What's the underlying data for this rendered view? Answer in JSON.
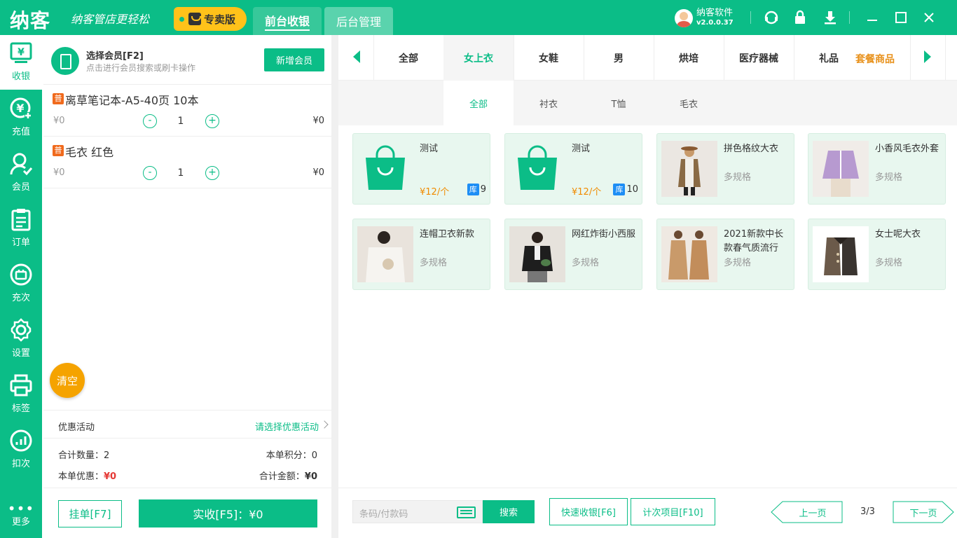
{
  "header": {
    "logo": "纳客",
    "slogan": "纳客管店更轻松",
    "edition": "专卖版",
    "tabs": [
      {
        "label": "前台收银",
        "active": true
      },
      {
        "label": "后台管理",
        "active": false
      }
    ],
    "user_name": "纳客软件",
    "version": "v2.0.0.37",
    "icons": [
      "headset-icon",
      "lock-icon",
      "download-icon"
    ],
    "window_controls": [
      "minimize",
      "maximize",
      "close"
    ]
  },
  "sidebar": {
    "items": [
      {
        "label": "收银",
        "icon": "cashier-icon",
        "active": true
      },
      {
        "label": "充值",
        "icon": "recharge-icon",
        "active": false
      },
      {
        "label": "会员",
        "icon": "member-icon",
        "active": false
      },
      {
        "label": "订单",
        "icon": "order-icon",
        "active": false
      },
      {
        "label": "充次",
        "icon": "count-recharge-icon",
        "active": false
      },
      {
        "label": "设置",
        "icon": "gear-icon",
        "active": false
      },
      {
        "label": "标签",
        "icon": "printer-icon",
        "active": false
      },
      {
        "label": "扣次",
        "icon": "deduct-icon",
        "active": false
      }
    ],
    "more_label": "更多"
  },
  "cart": {
    "member_title": "选择会员[F2]",
    "member_hint": "点击进行会员搜索或刷卡操作",
    "add_member_label": "新增会员",
    "items": [
      {
        "tag": "普",
        "name": "离草笔记本-A5-40页 10本",
        "unit_price": "¥0",
        "qty": "1",
        "total": "¥0"
      },
      {
        "tag": "普",
        "name": "毛衣 红色",
        "unit_price": "¥0",
        "qty": "1",
        "total": "¥0"
      }
    ],
    "minus": "-",
    "plus": "+",
    "clear_label": "清空",
    "promo_label": "优惠活动",
    "promo_select": "请选择优惠活动",
    "total_qty_label": "合计数量：",
    "total_qty": "2",
    "points_label": "本单积分：",
    "points": "0",
    "discount_label": "本单优惠：",
    "discount": "¥0",
    "total_amount_label": "合计金额：",
    "total_amount": "¥0",
    "hold_label": "挂单[F7]",
    "pay_label": "实收[F5]：¥0"
  },
  "categories": {
    "items": [
      "全部",
      "女上衣",
      "女鞋",
      "男",
      "烘培",
      "医疗器械",
      "礼品"
    ],
    "active_index": 1,
    "extra": "套餐商品",
    "sub_items": [
      "全部",
      "衬衣",
      "T恤",
      "毛衣"
    ],
    "sub_active_index": 0
  },
  "products": [
    {
      "name": "测试",
      "price": "¥12/个",
      "stock_tag": "库",
      "stock": "9",
      "image": "bag-icon"
    },
    {
      "name": "测试",
      "price": "¥12/个",
      "stock_tag": "库",
      "stock": "10",
      "image": "bag-icon"
    },
    {
      "name": "拼色格纹大衣",
      "spec": "多规格",
      "image": "coat-photo"
    },
    {
      "name": "小香风毛衣外套",
      "spec": "多规格",
      "image": "sweater-photo"
    },
    {
      "name": "连帽卫衣新款",
      "spec": "多规格",
      "image": "hoodie-photo"
    },
    {
      "name": "网红炸街小西服",
      "spec": "多规格",
      "image": "blazer-photo"
    },
    {
      "name": "2021新款中长款春气质流行",
      "spec": "多规格",
      "image": "trench-photo"
    },
    {
      "name": "女士呢大衣",
      "spec": "多规格",
      "image": "wool-coat-photo"
    }
  ],
  "bottom": {
    "barcode_placeholder": "条码/付款码",
    "search_label": "搜索",
    "quick_cash_label": "快速收银[F6]",
    "count_item_label": "计次项目[F10]",
    "prev_label": "上一页",
    "page_info": "3/3",
    "next_label": "下一页"
  },
  "colors": {
    "primary": "#0bbd87",
    "accent_orange": "#f5a300",
    "price_orange": "#f08b00",
    "edition_yellow": "#ffc21a",
    "stock_blue": "#1e8ef5",
    "tag_orange": "#f06a1d"
  }
}
